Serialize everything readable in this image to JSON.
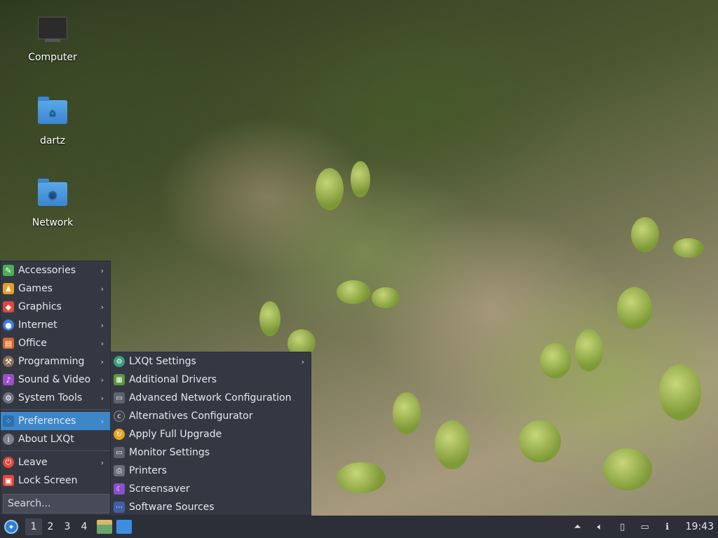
{
  "desktop": {
    "icons": [
      {
        "label": "Computer",
        "icon": "computer-icon"
      },
      {
        "label": "dartz",
        "icon": "home-folder-icon"
      },
      {
        "label": "Network",
        "icon": "network-folder-icon"
      }
    ]
  },
  "menu": {
    "items": [
      {
        "label": "Accessories",
        "icon": "accessories-icon",
        "color": "#4caf50"
      },
      {
        "label": "Games",
        "icon": "games-icon",
        "color": "#e6a02a"
      },
      {
        "label": "Graphics",
        "icon": "graphics-icon",
        "color": "#e0483b"
      },
      {
        "label": "Internet",
        "icon": "internet-icon",
        "color": "#3f7fd8"
      },
      {
        "label": "Office",
        "icon": "office-icon",
        "color": "#d46a2a"
      },
      {
        "label": "Programming",
        "icon": "programming-icon",
        "color": "#8a6f55"
      },
      {
        "label": "Sound & Video",
        "icon": "sound-video-icon",
        "color": "#9b4fc9"
      },
      {
        "label": "System Tools",
        "icon": "system-tools-icon",
        "color": "#6c7280"
      }
    ],
    "preferences": {
      "label": "Preferences",
      "icon": "preferences-icon"
    },
    "about": {
      "label": "About LXQt",
      "icon": "info-icon"
    },
    "leave": {
      "label": "Leave",
      "icon": "power-icon"
    },
    "lock": {
      "label": "Lock Screen",
      "icon": "lock-icon"
    },
    "search_placeholder": "Search..."
  },
  "submenu": {
    "items": [
      {
        "label": "LXQt Settings",
        "icon": "lxqt-settings-icon",
        "has_arrow": true
      },
      {
        "label": "Additional Drivers",
        "icon": "drivers-icon"
      },
      {
        "label": "Advanced Network Configuration",
        "icon": "network-config-icon"
      },
      {
        "label": "Alternatives Configurator",
        "icon": "alternatives-icon"
      },
      {
        "label": "Apply Full Upgrade",
        "icon": "upgrade-icon"
      },
      {
        "label": "Monitor Settings",
        "icon": "monitor-icon"
      },
      {
        "label": "Printers",
        "icon": "printer-icon"
      },
      {
        "label": "Screensaver",
        "icon": "screensaver-icon"
      },
      {
        "label": "Software Sources",
        "icon": "software-sources-icon"
      }
    ]
  },
  "taskbar": {
    "desktops": [
      "1",
      "2",
      "3",
      "4"
    ],
    "current_desktop": "1",
    "clock": "19:43"
  }
}
